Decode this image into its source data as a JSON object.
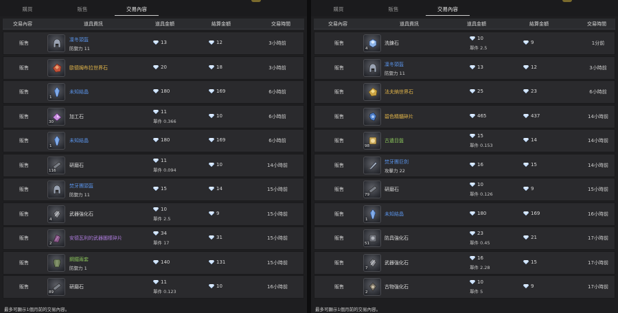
{
  "left": {
    "tabs": [
      {
        "label": "購買"
      },
      {
        "label": "販售"
      },
      {
        "label": "交易內容"
      }
    ],
    "columns": {
      "type": "交易內容",
      "item": "道具資訊",
      "price": "道具金額",
      "total": "結算金額",
      "time": "交易時間"
    },
    "rows": [
      {
        "type": "販售",
        "icon": "helmet-icon",
        "count": "",
        "name": "凜冬頭盔",
        "grade": "blue",
        "sub": "防禦力 11",
        "price": "13",
        "unit": "",
        "total": "12",
        "time": "3小時前"
      },
      {
        "type": "販售",
        "icon": "red-ore-icon",
        "count": "",
        "name": "歐德姆布拉世界石",
        "grade": "gold",
        "sub": "",
        "price": "20",
        "unit": "",
        "total": "18",
        "time": "3小時前"
      },
      {
        "type": "販售",
        "icon": "crystal-icon",
        "count": "1",
        "name": "未知結晶",
        "grade": "blue",
        "sub": "",
        "price": "180",
        "unit": "",
        "total": "169",
        "time": "6小時前"
      },
      {
        "type": "販售",
        "icon": "pink-gem-icon",
        "count": "30",
        "name": "加工石",
        "grade": "white",
        "sub": "",
        "price": "11",
        "unit": "單件 0.366",
        "total": "10",
        "time": "6小時前"
      },
      {
        "type": "販售",
        "icon": "crystal-icon",
        "count": "1",
        "name": "未知結晶",
        "grade": "blue",
        "sub": "",
        "price": "180",
        "unit": "",
        "total": "169",
        "time": "6小時前"
      },
      {
        "type": "販售",
        "icon": "whetstone-icon",
        "count": "116",
        "name": "研磨石",
        "grade": "white",
        "sub": "",
        "price": "11",
        "unit": "單件 0.094",
        "total": "10",
        "time": "14小時前"
      },
      {
        "type": "販售",
        "icon": "helmet-icon",
        "count": "",
        "name": "焚牙團頭盔",
        "grade": "blue",
        "sub": "防禦力 11",
        "price": "15",
        "unit": "",
        "total": "14",
        "time": "15小時前"
      },
      {
        "type": "販售",
        "icon": "weapon-stone-icon",
        "count": "4",
        "name": "武器強化石",
        "grade": "white",
        "sub": "",
        "price": "10",
        "unit": "單件 2.5",
        "total": "9",
        "time": "15小時前"
      },
      {
        "type": "販售",
        "icon": "fragment-icon",
        "count": "2",
        "name": "安德瓦利的武器圖樣碎片",
        "grade": "purple",
        "sub": "",
        "price": "34",
        "unit": "單件 17",
        "total": "31",
        "time": "15小時前"
      },
      {
        "type": "販售",
        "icon": "armor-icon",
        "count": "",
        "name": "鋼鐵兩套",
        "grade": "green",
        "sub": "防禦力 1",
        "price": "140",
        "unit": "",
        "total": "131",
        "time": "15小時前"
      },
      {
        "type": "販售",
        "icon": "whetstone-icon",
        "count": "89",
        "name": "研磨石",
        "grade": "white",
        "sub": "",
        "price": "11",
        "unit": "單件 0.123",
        "total": "10",
        "time": "16小時前"
      }
    ],
    "footer": "最多可顯示1個月前的交易內容。"
  },
  "right": {
    "tabs": [
      {
        "label": "購買"
      },
      {
        "label": "販售"
      },
      {
        "label": "交易內容"
      }
    ],
    "columns": {
      "type": "交易內容",
      "item": "道具資訊",
      "price": "道具金額",
      "total": "結算金額",
      "time": "交易時間"
    },
    "rows": [
      {
        "type": "販售",
        "icon": "wash-stone-icon",
        "count": "4",
        "name": "洗鍊石",
        "grade": "white",
        "sub": "",
        "price": "10",
        "unit": "單件 2.5",
        "total": "9",
        "time": "1分前"
      },
      {
        "type": "販售",
        "icon": "helmet-icon",
        "count": "",
        "name": "凜冬頭盔",
        "grade": "blue",
        "sub": "防禦力 11",
        "price": "13",
        "unit": "",
        "total": "12",
        "time": "3小時前"
      },
      {
        "type": "販售",
        "icon": "gold-ore-icon",
        "count": "",
        "name": "法夫納世界石",
        "grade": "gold",
        "sub": "",
        "price": "25",
        "unit": "",
        "total": "23",
        "time": "6小時前"
      },
      {
        "type": "販售",
        "icon": "blue-shard-icon",
        "count": "",
        "name": "碧色精髓碎片",
        "grade": "gold",
        "sub": "",
        "price": "465",
        "unit": "",
        "total": "437",
        "time": "14小時前"
      },
      {
        "type": "販售",
        "icon": "relic-icon",
        "count": "98",
        "name": "古遺目盤",
        "grade": "green",
        "sub": "",
        "price": "15",
        "unit": "單件 0.153",
        "total": "14",
        "time": "14小時前"
      },
      {
        "type": "販售",
        "icon": "sword-icon",
        "count": "",
        "name": "焚牙團巨劍",
        "grade": "blue",
        "sub": "攻擊力 22",
        "price": "16",
        "unit": "",
        "total": "15",
        "time": "14小時前"
      },
      {
        "type": "販售",
        "icon": "whetstone-icon",
        "count": "79",
        "name": "研磨石",
        "grade": "white",
        "sub": "",
        "price": "10",
        "unit": "單件 0.126",
        "total": "9",
        "time": "15小時前"
      },
      {
        "type": "販售",
        "icon": "crystal-icon",
        "count": "1",
        "name": "未知結晶",
        "grade": "blue",
        "sub": "",
        "price": "180",
        "unit": "",
        "total": "169",
        "time": "16小時前"
      },
      {
        "type": "販售",
        "icon": "armor-stone-icon",
        "count": "51",
        "name": "防具強化石",
        "grade": "white",
        "sub": "",
        "price": "23",
        "unit": "單件 0.45",
        "total": "21",
        "time": "17小時前"
      },
      {
        "type": "販售",
        "icon": "weapon-stone-icon",
        "count": "7",
        "name": "武器強化石",
        "grade": "white",
        "sub": "",
        "price": "16",
        "unit": "單件 2.28",
        "total": "15",
        "time": "17小時前"
      },
      {
        "type": "販售",
        "icon": "ancient-stone-icon",
        "count": "2",
        "name": "古物強化石",
        "grade": "white",
        "sub": "",
        "price": "10",
        "unit": "單件 5",
        "total": "9",
        "time": "17小時前"
      }
    ],
    "footer": "最多可顯示1個月前的交易內容。"
  },
  "colors": {
    "blue": "#5a93e8",
    "gold": "#e6b84a",
    "purple": "#ad7bdc",
    "green": "#86bd59",
    "white": "#dcdcdc",
    "accent_gem": "#cfe3ff"
  }
}
